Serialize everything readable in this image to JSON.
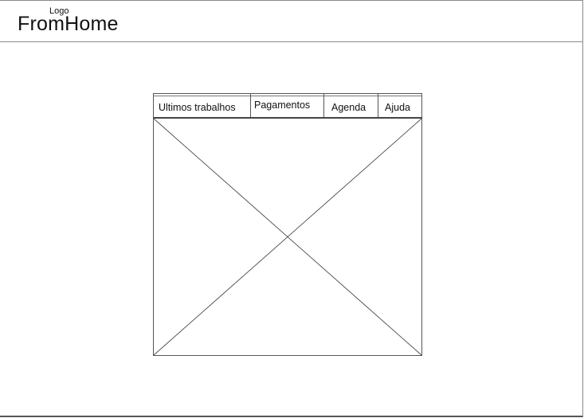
{
  "header": {
    "logo_caption": "Logo",
    "brand_name": "FromHome"
  },
  "tabs": [
    {
      "label": "Ultimos trabalhos"
    },
    {
      "label": "Pagamentos"
    },
    {
      "label": "Agenda"
    },
    {
      "label": "Ajuda"
    }
  ],
  "content": {
    "icon": "image-placeholder-icon"
  },
  "colors": {
    "background": "#ffffff",
    "line": "#555555",
    "text": "#111111"
  }
}
